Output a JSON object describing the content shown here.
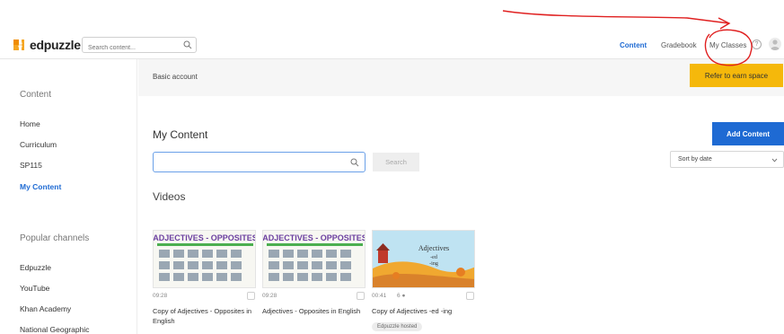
{
  "topbar": {
    "logo_text": "edpuzzle",
    "search_placeholder": "Search content...",
    "nav": {
      "content": "Content",
      "gradebook": "Gradebook",
      "my_classes": "My Classes"
    },
    "help_symbol": "?"
  },
  "sidebar": {
    "content_heading": "Content",
    "items": [
      "Home",
      "Curriculum",
      "SP115",
      "My Content"
    ],
    "active_item": "My Content",
    "channels_heading": "Popular channels",
    "channels": [
      "Edpuzzle",
      "YouTube",
      "Khan Academy",
      "National Geographic"
    ]
  },
  "banner": {
    "text": "Basic account",
    "button_label": "Refer to earn space"
  },
  "main": {
    "title": "My Content",
    "add_button_label": "Add Content",
    "search_value": "",
    "search_button_label": "Search",
    "sort_label": "Sort by date",
    "videos_heading": "Videos"
  },
  "cards": [
    {
      "thumb_heading": "ADJECTIVES - OPPOSITES",
      "duration": "09:28",
      "extra": "",
      "title": "Copy of Adjectives - Opposites in English",
      "tag": ""
    },
    {
      "thumb_heading": "ADJECTIVES - OPPOSITES",
      "duration": "09:28",
      "extra": "",
      "title": "Adjectives - Opposites in English",
      "tag": ""
    },
    {
      "thumb_line1": "Adjectives",
      "thumb_line2": "-ed",
      "thumb_line3": "-ing",
      "duration": "00:41",
      "extra": "6",
      "title": "Copy of Adjectives -ed -ing",
      "tag": "Edpuzzle hosted"
    }
  ],
  "colors": {
    "accent": "#1e6ad3",
    "refer_button": "#f5b80b",
    "annotation": "#e02020",
    "banner_bg": "#f6f6f6"
  }
}
